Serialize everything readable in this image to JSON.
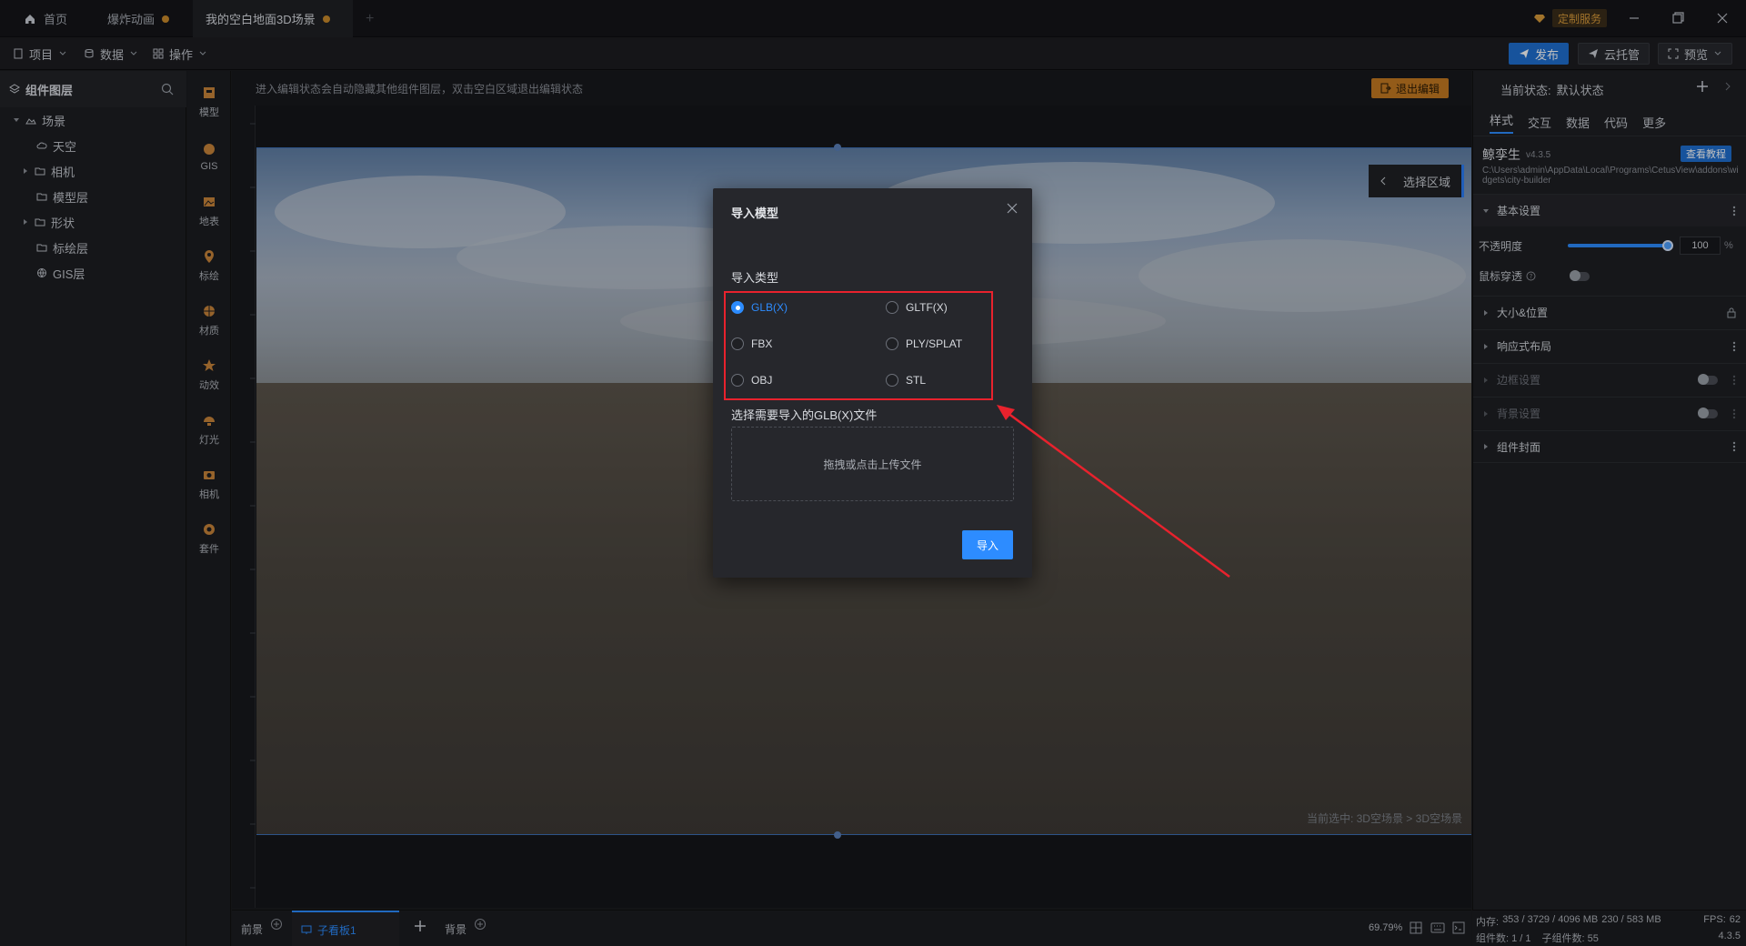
{
  "titlebar": {
    "tabs": [
      {
        "label": "首页"
      },
      {
        "label": "爆炸动画"
      },
      {
        "label": "我的空白地面3D场景"
      }
    ],
    "custom_service": "定制服务"
  },
  "menubar": {
    "project": "项目",
    "data": "数据",
    "operation": "操作",
    "publish": "发布",
    "cloud": "云托管",
    "preview": "预览"
  },
  "layers": {
    "title": "组件图层",
    "items": [
      {
        "label": "场景"
      },
      {
        "label": "天空"
      },
      {
        "label": "相机"
      },
      {
        "label": "模型层"
      },
      {
        "label": "形状"
      },
      {
        "label": "标绘层"
      },
      {
        "label": "GIS层"
      }
    ]
  },
  "tools": [
    {
      "label": "模型"
    },
    {
      "label": "GIS"
    },
    {
      "label": "地表"
    },
    {
      "label": "标绘"
    },
    {
      "label": "材质"
    },
    {
      "label": "动效"
    },
    {
      "label": "灯光"
    },
    {
      "label": "相机"
    },
    {
      "label": "套件"
    }
  ],
  "canvas": {
    "hint": "进入编辑状态会自动隐藏其他组件图层，双击空白区域退出编辑状态",
    "exit_edit": "退出编辑",
    "select_area": "选择区域",
    "breadcrumb": "当前选中: 3D空场景 > 3D空场景"
  },
  "modal": {
    "title": "导入模型",
    "type_label": "导入类型",
    "options": [
      {
        "label": "GLB(X)"
      },
      {
        "label": "GLTF(X)"
      },
      {
        "label": "FBX"
      },
      {
        "label": "PLY/SPLAT"
      },
      {
        "label": "OBJ"
      },
      {
        "label": "STL"
      }
    ],
    "selected": "GLB(X)",
    "file_label": "选择需要导入的GLB(X)文件",
    "upload_hint": "拖拽或点击上传文件",
    "import_button": "导入"
  },
  "rightpanel": {
    "state_label": "当前状态:",
    "state_value": "默认状态",
    "tabs": [
      {
        "label": "样式"
      },
      {
        "label": "交互"
      },
      {
        "label": "数据"
      },
      {
        "label": "代码"
      },
      {
        "label": "更多"
      }
    ],
    "component_name": "鲸孪生",
    "version": "v4.3.5",
    "tutorial": "查看教程",
    "path": "C:\\Users\\admin\\AppData\\Local\\Programs\\CetusView\\addons\\widgets\\city-builder",
    "basic_settings": "基本设置",
    "opacity_label": "不透明度",
    "opacity_value": "100",
    "opacity_unit": "%",
    "mouse_through": "鼠标穿透",
    "sections": [
      {
        "label": "大小&位置"
      },
      {
        "label": "响应式布局"
      },
      {
        "label": "边框设置"
      },
      {
        "label": "背景设置"
      },
      {
        "label": "组件封面"
      }
    ]
  },
  "bottombar": {
    "foreground": "前景",
    "subboard": "子看板1",
    "background": "背景",
    "zoom": "69.79%"
  },
  "status": {
    "memory_label": "内存:",
    "memory_value": "353 / 3729 / 4096 MB",
    "memory2": "230 / 583 MB",
    "fps_label": "FPS:",
    "fps_value": "62",
    "components": "组件数: 1 / 1",
    "subcomponents": "子组件数: 55",
    "version": "4.3.5"
  },
  "colors": {
    "accent": "#2d8cff",
    "annotation": "#e8222d",
    "exit_button": "#c57a22"
  }
}
